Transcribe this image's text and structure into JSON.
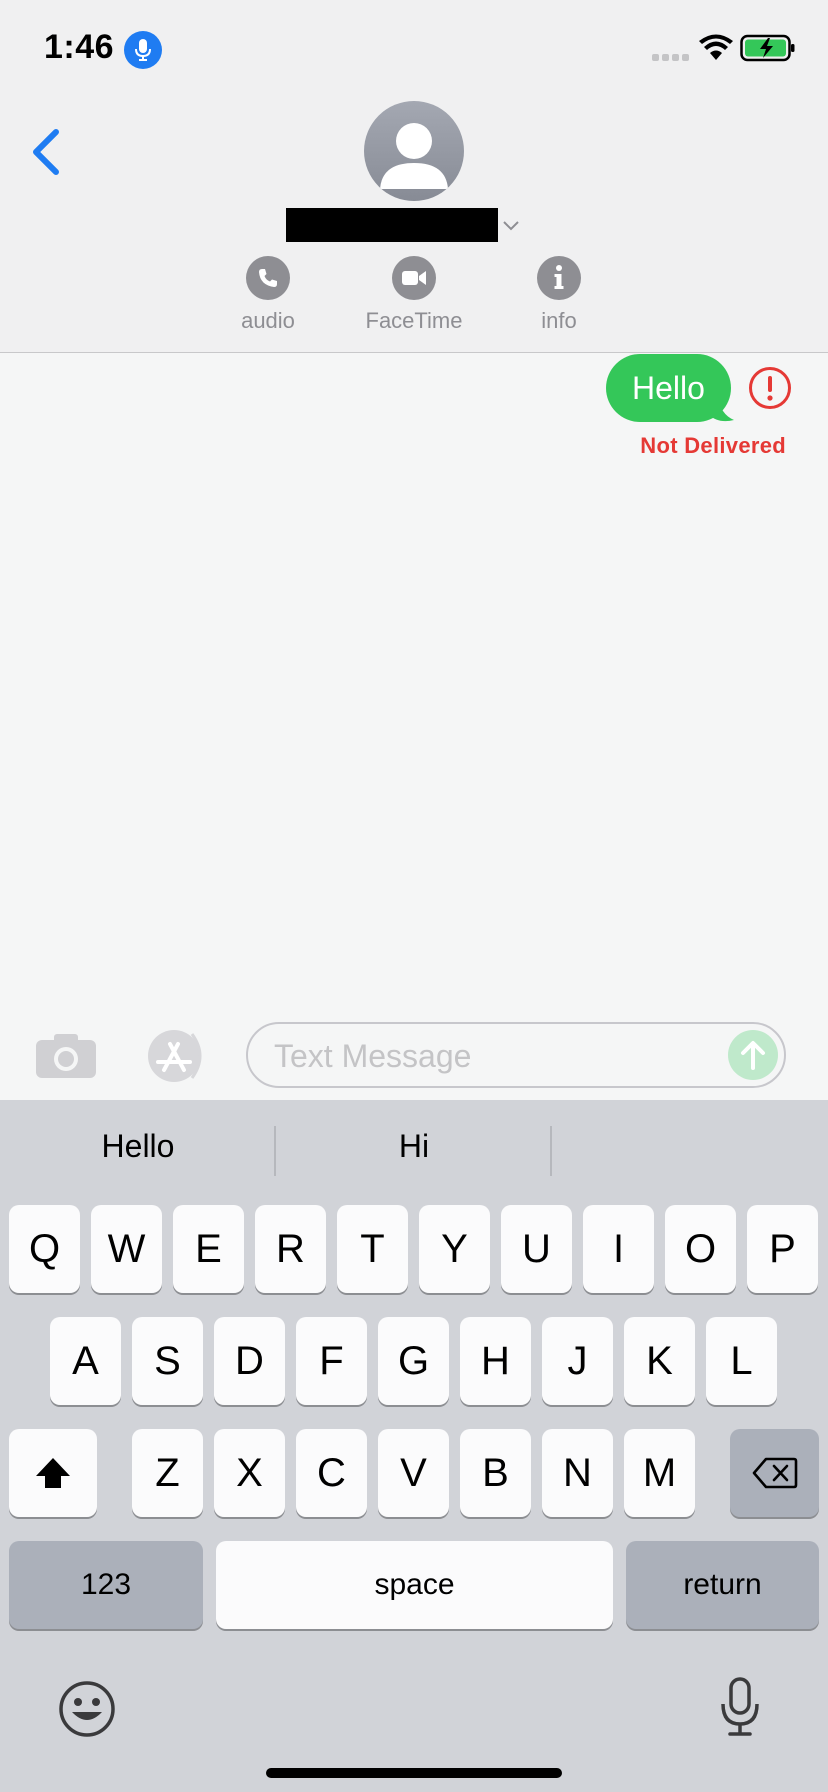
{
  "status_bar": {
    "time": "1:46"
  },
  "header": {
    "actions": [
      {
        "label": "audio",
        "icon": "phone-icon"
      },
      {
        "label": "FaceTime",
        "icon": "video-camera-icon"
      },
      {
        "label": "info",
        "icon": "info-icon"
      }
    ]
  },
  "conversation": {
    "messages": [
      {
        "text": "Hello",
        "status": "Not Delivered",
        "color": "#34c759"
      }
    ],
    "error_color": "#e53935"
  },
  "composer": {
    "placeholder": "Text Message"
  },
  "keyboard": {
    "predictions": [
      "Hello",
      "Hi",
      ""
    ],
    "row1": [
      "Q",
      "W",
      "E",
      "R",
      "T",
      "Y",
      "U",
      "I",
      "O",
      "P"
    ],
    "row2": [
      "A",
      "S",
      "D",
      "F",
      "G",
      "H",
      "J",
      "K",
      "L"
    ],
    "row3": [
      "Z",
      "X",
      "C",
      "V",
      "B",
      "N",
      "M"
    ],
    "numbers_label": "123",
    "space_label": "space",
    "return_label": "return"
  }
}
